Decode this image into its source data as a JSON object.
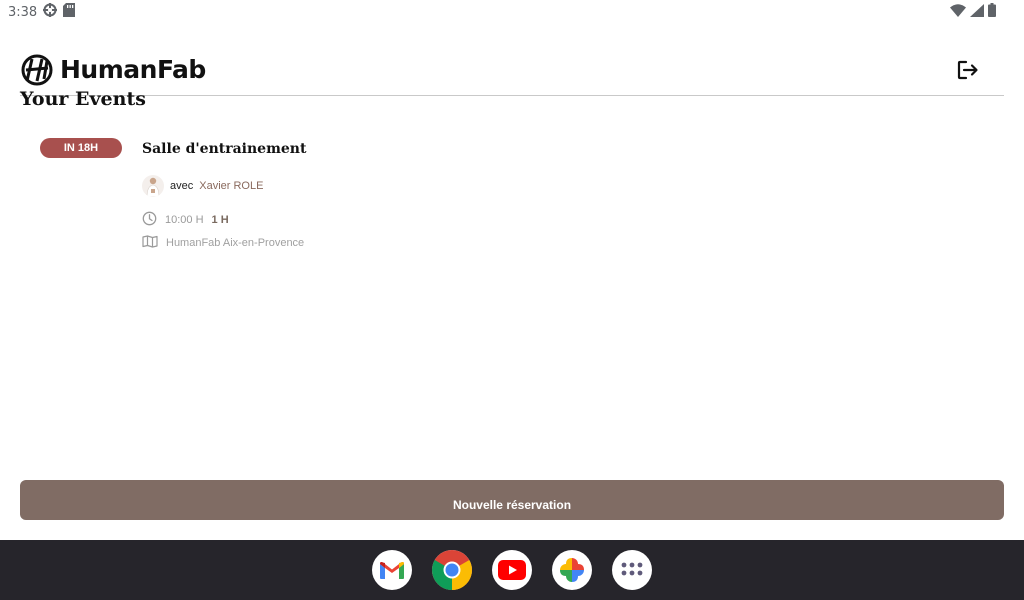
{
  "status_bar": {
    "time": "3:38",
    "icons": [
      "settings-icon",
      "sd-card-icon",
      "wifi-icon",
      "signal-icon",
      "battery-icon"
    ]
  },
  "header": {
    "brand": "HumanFab",
    "logout_icon": "logout-icon"
  },
  "page_title": "Your Events",
  "events": [
    {
      "badge": "IN 18H",
      "title": "Salle d'entrainement",
      "with_label": "avec",
      "coach": "Xavier ROLE",
      "time": "10:00 H",
      "duration": "1 H",
      "location": "HumanFab Aix-en-Provence"
    }
  ],
  "new_reservation_label": "Nouvelle réservation",
  "taskbar": {
    "apps": [
      "gmail-icon",
      "chrome-icon",
      "youtube-icon",
      "photos-icon",
      "app-drawer-icon"
    ]
  },
  "colors": {
    "badge": "#a8504e",
    "button": "#806c64",
    "coach": "#8a6a5e",
    "taskbar": "#26252b"
  }
}
